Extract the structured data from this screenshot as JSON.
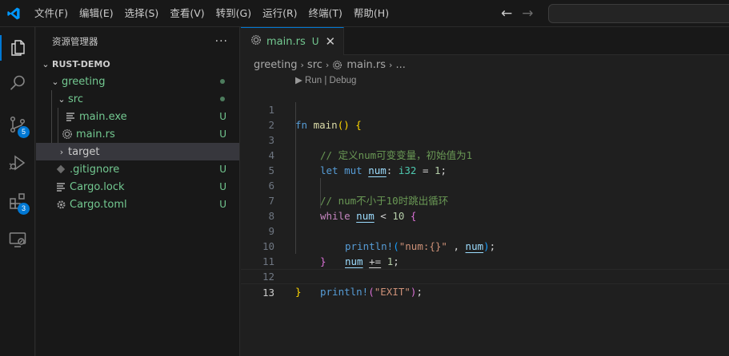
{
  "menu": [
    "文件(F)",
    "编辑(E)",
    "选择(S)",
    "查看(V)",
    "转到(G)",
    "运行(R)",
    "终端(T)",
    "帮助(H)"
  ],
  "nav": {
    "back": "←",
    "forward": "→"
  },
  "activity": {
    "items": [
      "explorer-icon",
      "search-icon",
      "source-control-icon",
      "run-debug-icon",
      "extensions-icon",
      "remote-explorer-icon"
    ],
    "source_control_badge": "5",
    "extensions_badge": "3",
    "accent": "#0078d4"
  },
  "sidebar": {
    "title": "资源管理器",
    "more": "···",
    "tree": [
      {
        "label": "RUST-DEMO",
        "kind": "root"
      },
      {
        "label": "greeting",
        "kind": "folder",
        "status": "dot"
      },
      {
        "label": "src",
        "kind": "folder",
        "status": "dot"
      },
      {
        "label": "main.exe",
        "kind": "file",
        "status": "U"
      },
      {
        "label": "main.rs",
        "kind": "file",
        "status": "U"
      },
      {
        "label": "target",
        "kind": "folder"
      },
      {
        "label": ".gitignore",
        "kind": "file",
        "status": "U"
      },
      {
        "label": "Cargo.lock",
        "kind": "file",
        "status": "U"
      },
      {
        "label": "Cargo.toml",
        "kind": "file",
        "status": "U"
      }
    ]
  },
  "editor": {
    "tab": {
      "label": "main.rs",
      "status": "U",
      "close": "✕"
    },
    "breadcrumb": [
      "greeting",
      "src",
      "main.rs",
      "..."
    ],
    "codelens": "▶ Run | Debug",
    "line_numbers": [
      "1",
      "2",
      "3",
      "4",
      "5",
      "6",
      "7",
      "8",
      "9",
      "10",
      "11",
      "12",
      "13"
    ],
    "current_line": 13,
    "code": {
      "l1": {
        "fn": "fn",
        "name": "main",
        "rest": "() {"
      },
      "l2": "// 定义num可变变量，初始值为1",
      "l3": {
        "let": "let",
        "mut": "mut",
        "var": "num",
        "colon": ": ",
        "type": "i32",
        "eq": " = ",
        "val": "1",
        "semi": ";"
      },
      "l5": "// num不小于10时跳出循环",
      "l6": {
        "kw": "while",
        "var": "num",
        "op": " < ",
        "val": "10",
        "brace": "{"
      },
      "l7": {
        "macro": "println!",
        "open": "(",
        "str": "\"num:{}\"",
        "comma": " , ",
        "var": "num",
        "close": ")",
        "semi": ";"
      },
      "l8": {
        "var": "num",
        "op": "+=",
        "val": "1",
        "semi": ";"
      },
      "l9": "}",
      "l11": {
        "macro": "println!",
        "open": "(",
        "str": "\"EXIT\"",
        "close": ")",
        "semi": ";"
      },
      "l12": "}"
    }
  }
}
